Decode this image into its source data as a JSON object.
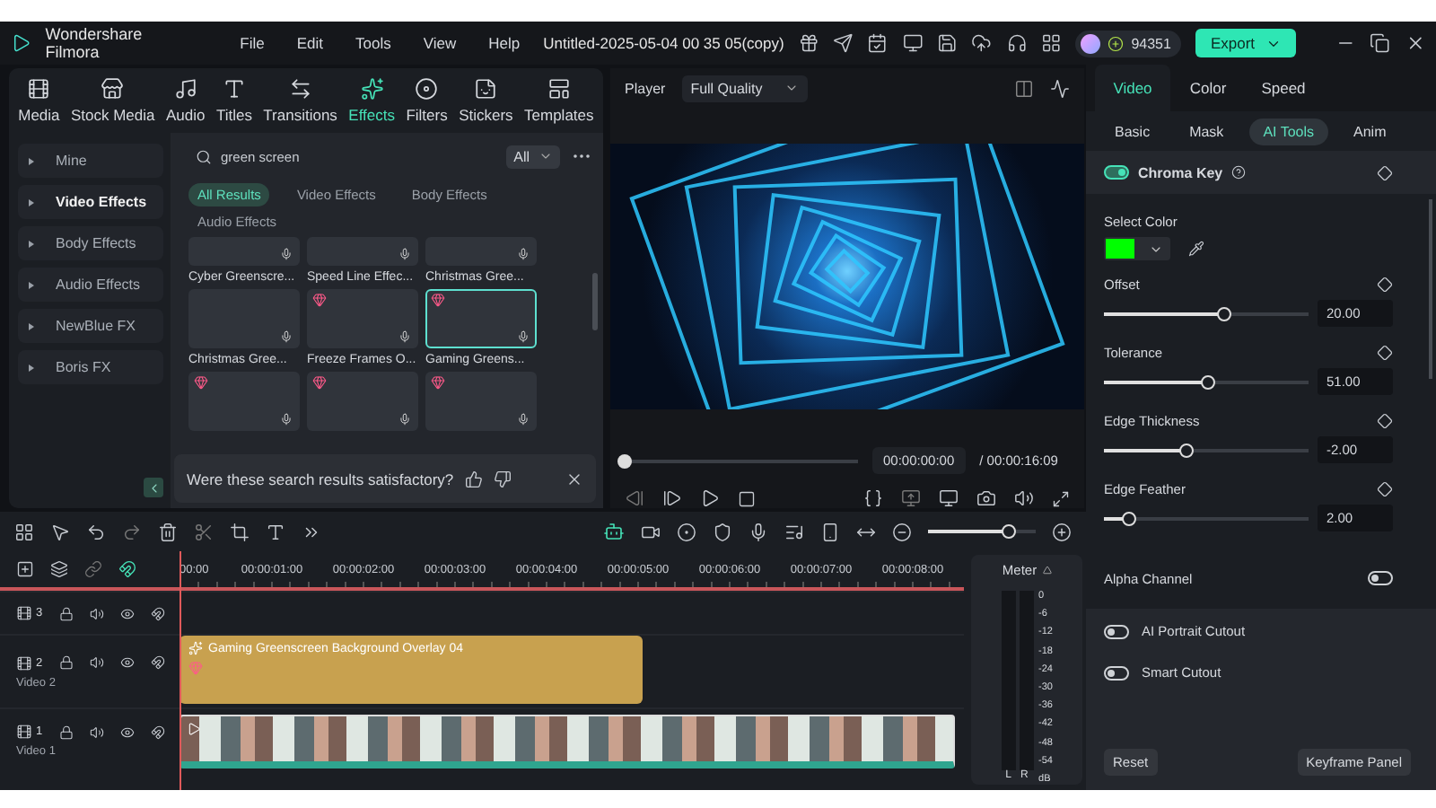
{
  "title_bar": {
    "app_name": "Wondershare Filmora",
    "menu": [
      "File",
      "Edit",
      "Tools",
      "View",
      "Help"
    ],
    "document_title": "Untitled-2025-05-04 00 35 05(copy)",
    "credits": "94351",
    "export_button": "Export"
  },
  "media_toolbar": [
    {
      "label": "Media",
      "selected": false
    },
    {
      "label": "Stock Media",
      "selected": false
    },
    {
      "label": "Audio",
      "selected": false
    },
    {
      "label": "Titles",
      "selected": false
    },
    {
      "label": "Transitions",
      "selected": false
    },
    {
      "label": "Effects",
      "selected": true
    },
    {
      "label": "Filters",
      "selected": false
    },
    {
      "label": "Stickers",
      "selected": false
    },
    {
      "label": "Templates",
      "selected": false
    }
  ],
  "categories": [
    {
      "label": "Mine",
      "selected": false
    },
    {
      "label": "Video Effects",
      "selected": true
    },
    {
      "label": "Body Effects",
      "selected": false
    },
    {
      "label": "Audio Effects",
      "selected": false
    },
    {
      "label": "NewBlue FX",
      "selected": false
    },
    {
      "label": "Boris FX",
      "selected": false
    }
  ],
  "search": {
    "value": "green screen",
    "scope": "All"
  },
  "filter_tabs": [
    {
      "label": "All Results",
      "selected": true
    },
    {
      "label": "Video Effects",
      "selected": false
    },
    {
      "label": "Body Effects",
      "selected": false
    },
    {
      "label": "Audio Effects",
      "selected": false
    }
  ],
  "results": [
    {
      "name": "Cyber Greenscre...",
      "premium": false,
      "selected": false
    },
    {
      "name": "Speed Line Effec...",
      "premium": false,
      "selected": false
    },
    {
      "name": "Christmas Gree...",
      "premium": false,
      "selected": false
    },
    {
      "name": "Christmas Gree...",
      "premium": false,
      "selected": false
    },
    {
      "name": "Freeze Frames O...",
      "premium": true,
      "selected": false
    },
    {
      "name": "Gaming Greens...",
      "premium": true,
      "selected": true
    },
    {
      "premium": true,
      "selected": false
    },
    {
      "premium": true,
      "selected": false
    },
    {
      "premium": true,
      "selected": false
    }
  ],
  "feedback": {
    "question": "Were these search results satisfactory?"
  },
  "player": {
    "label": "Player",
    "quality": "Full Quality",
    "level": 0,
    "current_time": "00:00:00:00",
    "total_time": "/ 00:00:16:09"
  },
  "properties": {
    "tabs": [
      {
        "label": "Video",
        "selected": true
      },
      {
        "label": "Color",
        "selected": false
      },
      {
        "label": "Speed",
        "selected": false
      }
    ],
    "subtabs": [
      {
        "label": "Basic",
        "selected": false
      },
      {
        "label": "Mask",
        "selected": false
      },
      {
        "label": "AI Tools",
        "selected": true
      },
      {
        "label": "Anim",
        "selected": false
      }
    ],
    "chroma_key": {
      "label": "Chroma Key",
      "on": true
    },
    "select_color": {
      "label": "Select Color",
      "color": "#00ff00"
    },
    "sliders": [
      {
        "label": "Offset",
        "level": 0.59,
        "value": "20.00"
      },
      {
        "label": "Tolerance",
        "level": 0.51,
        "value": "51.00"
      },
      {
        "label": "Edge Thickness",
        "level": 0.4,
        "value": "-2.00"
      },
      {
        "label": "Edge Feather",
        "level": 0.12,
        "value": "2.00"
      }
    ],
    "alpha_channel": {
      "label": "Alpha Channel",
      "on": false
    },
    "cutouts": [
      {
        "label": "AI Portrait Cutout",
        "on": false
      },
      {
        "label": "Smart Cutout",
        "on": false
      }
    ],
    "buttons": [
      "Reset",
      "Keyframe Panel"
    ]
  },
  "timeline": {
    "zoom": {
      "level": 0.75
    },
    "ruler": [
      "00:00",
      "00:00:01:00",
      "00:00:02:00",
      "00:00:03:00",
      "00:00:04:00",
      "00:00:05:00",
      "00:00:06:00",
      "00:00:07:00",
      "00:00:08:00"
    ],
    "tracks": [
      {
        "number": "3"
      },
      {
        "number": "2",
        "name": "Video 2",
        "clip": {
          "kind": "effect",
          "title": "Gaming Greenscreen Background Overlay 04"
        }
      },
      {
        "number": "1",
        "name": "Video 1",
        "clip": {
          "kind": "video"
        }
      }
    ],
    "meter": {
      "label": "Meter",
      "scale": [
        "0",
        "-6",
        "-12",
        "-18",
        "-24",
        "-30",
        "-36",
        "-42",
        "-48",
        "-54",
        "dB"
      ],
      "channels": [
        "L",
        "R"
      ]
    }
  }
}
